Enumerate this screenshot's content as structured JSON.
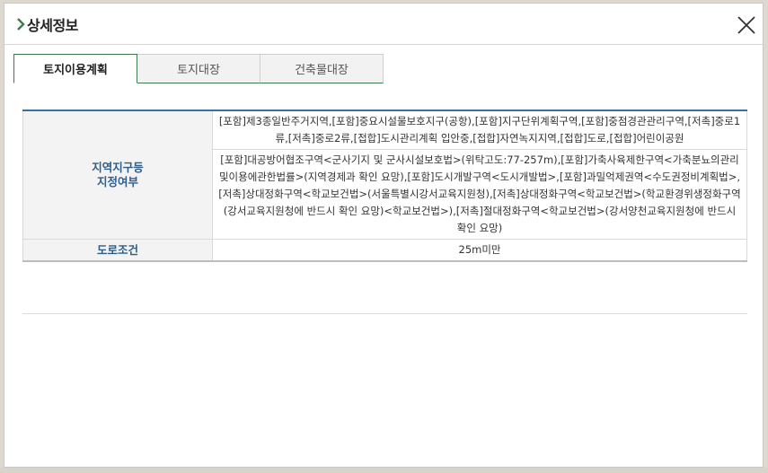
{
  "dialog": {
    "title": "상세정보",
    "close_label": "닫기"
  },
  "tabs": [
    {
      "label": "토지이용계획",
      "active": true
    },
    {
      "label": "토지대장",
      "active": false
    },
    {
      "label": "건축물대장",
      "active": false
    }
  ],
  "table": {
    "rows": [
      {
        "header": "지역지구등 지정여부",
        "header_lines": [
          "지역지구등",
          "지정여부"
        ],
        "values": [
          "[포함]제3종일반주거지역,[포함]중요시설물보호지구(공항),[포함]지구단위계획구역,[포함]중점경관관리구역,[저촉]중로1류,[저촉]중로2류,[접합]도시관리계획 입안중,[접합]자연녹지지역,[접합]도로,[접합]어린이공원",
          "[포함]대공방어협조구역<군사기지 및 군사시설보호법>(위탁고도:77-257m),[포함]가축사육제한구역<가축분뇨의관리및이용에관한법률>(지역경제과 확인 요망),[포함]도시개발구역<도시개발법>,[포함]과밀억제권역<수도권정비계획법>,[저촉]상대정화구역<학교보건법>(서울특별시강서교육지원청),[저촉]상대정화구역<학교보건법>(학교환경위생정화구역(강서교육지원청에 반드시 확인 요망)<학교보건법>),[저촉]절대정화구역<학교보건법>(강서양천교육지원청에 반드시 확인 요망)"
        ]
      },
      {
        "header": "도로조건",
        "values": [
          "25m미만"
        ]
      }
    ]
  },
  "colors": {
    "accent_green": "#3f7a4c",
    "header_blue": "#2f5d8a",
    "table_top_border": "#3a6ea5"
  },
  "icons": {
    "title": "chevron-right-icon",
    "close": "close-icon"
  }
}
